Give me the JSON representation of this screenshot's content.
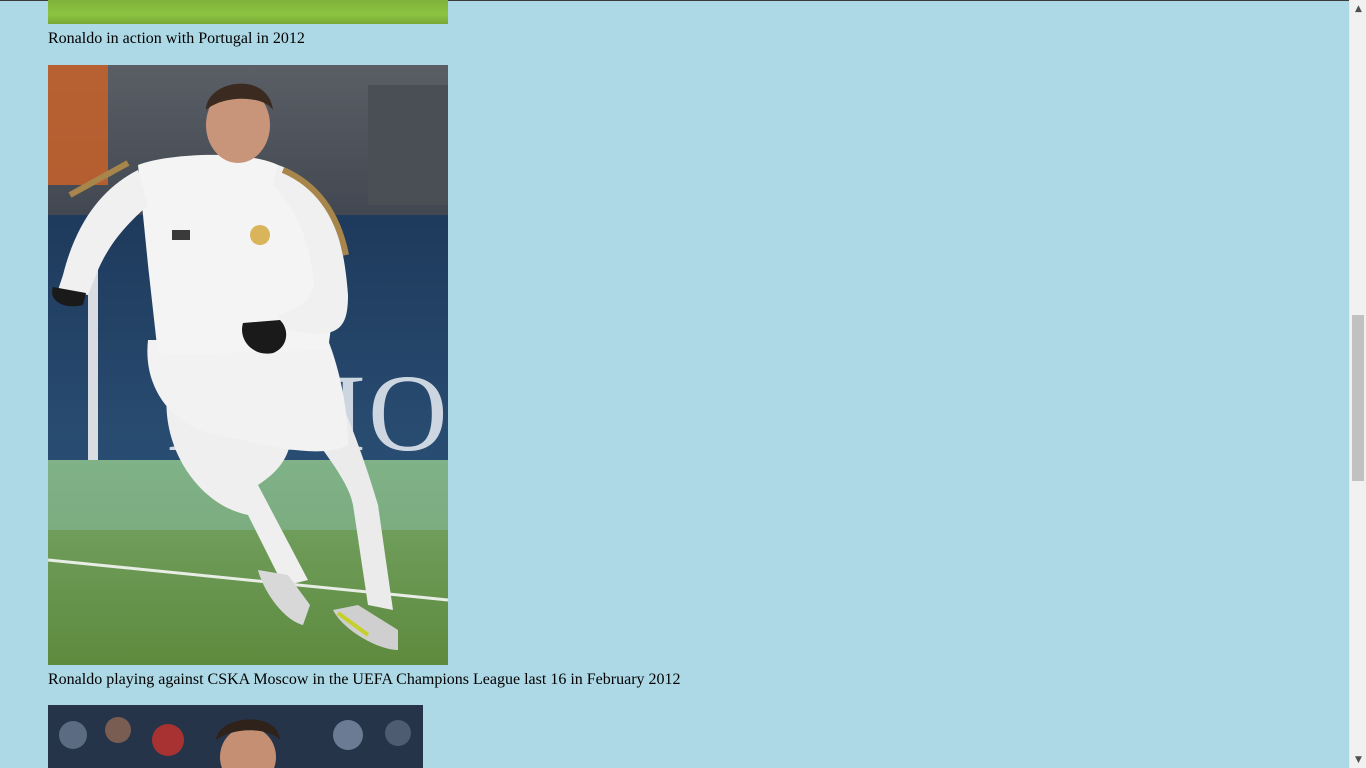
{
  "article": {
    "figures": [
      {
        "caption": "Ronaldo in action with Portugal in 2012"
      },
      {
        "caption": "Ronaldo playing against CSKA Moscow in the UEFA Champions League last 16 in February 2012",
        "banner_text": "CHAMPIONS"
      },
      {
        "caption": ""
      }
    ]
  },
  "scrollbar": {
    "up_icon": "chevron-up-icon",
    "down_icon": "chevron-down-icon",
    "position_fraction": 0.46,
    "visible_fraction": 0.22
  },
  "colors": {
    "page_background": "#add8e6",
    "grass": "#7fb23a",
    "kit": "#f2f2f2",
    "trim": "#a8864b"
  }
}
